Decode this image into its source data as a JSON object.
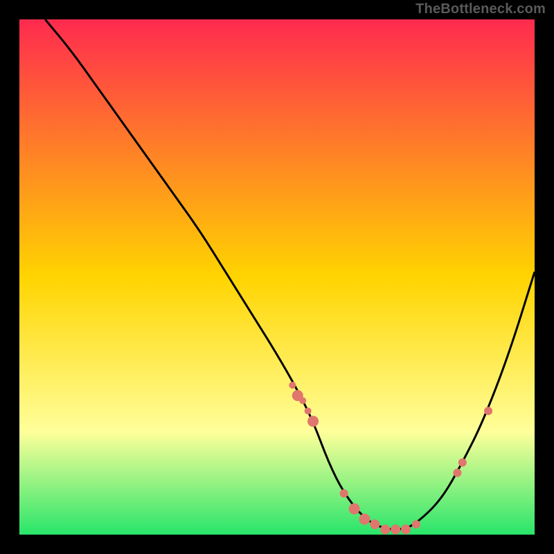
{
  "watermark": "TheBottleneck.com",
  "colors": {
    "background": "#000000",
    "gradient_top": "#ff2a4f",
    "gradient_mid": "#ffd400",
    "gradient_low": "#ffff9a",
    "gradient_bottom": "#28e56a",
    "curve": "#000000",
    "marker": "#e0766d"
  },
  "chart_data": {
    "type": "line",
    "title": "",
    "xlabel": "",
    "ylabel": "",
    "xlim": [
      0,
      100
    ],
    "ylim": [
      0,
      100
    ],
    "series": [
      {
        "name": "curve",
        "x": [
          5,
          10,
          15,
          20,
          25,
          30,
          35,
          40,
          45,
          50,
          54,
          57,
          60,
          63,
          67,
          71,
          75,
          78,
          82,
          86,
          90,
          95,
          100
        ],
        "values": [
          100,
          94,
          87,
          80,
          73,
          66,
          59,
          51,
          43,
          35,
          28,
          22,
          14,
          8,
          3,
          1,
          1,
          3,
          7,
          14,
          22,
          35,
          51
        ]
      }
    ],
    "markers": {
      "name": "highlight-dots",
      "x": [
        53,
        54,
        55,
        56,
        57,
        63,
        65,
        67,
        69,
        71,
        73,
        75,
        77,
        85,
        86,
        91
      ],
      "y": [
        29,
        27,
        26,
        24,
        22,
        8,
        5,
        3,
        2,
        1,
        1,
        1,
        2,
        12,
        14,
        24
      ],
      "size": [
        5,
        8,
        5,
        5,
        8,
        6,
        8,
        8,
        7,
        7,
        7,
        7,
        6,
        6,
        6,
        6
      ]
    }
  }
}
